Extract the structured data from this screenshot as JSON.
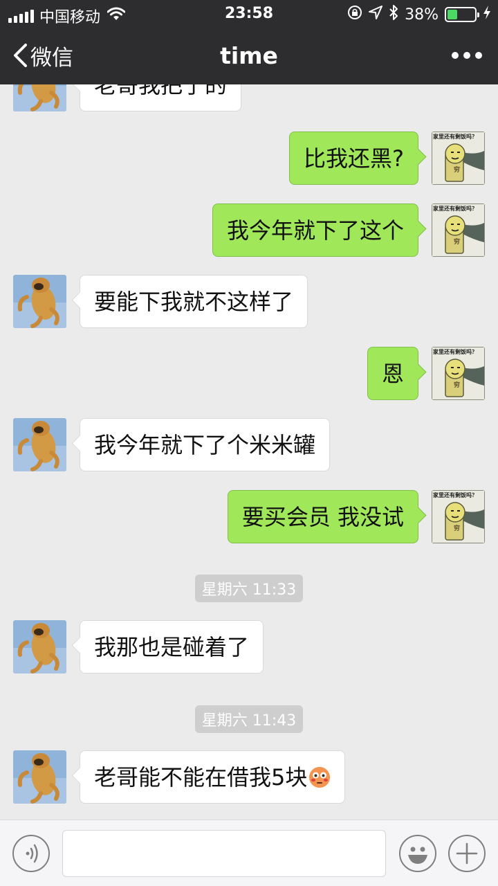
{
  "status_bar": {
    "carrier": "中国移动",
    "time": "23:58",
    "battery_percent": "38%",
    "battery_level": 0.38,
    "icons": [
      "signal-icon",
      "wifi-icon",
      "lock-rotation-icon",
      "location-icon",
      "bluetooth-icon",
      "battery-icon",
      "charging-icon"
    ]
  },
  "nav": {
    "back_label": "微信",
    "title": "time",
    "more_icon": "more-icon"
  },
  "colors": {
    "nav_bg": "#2d2d2f",
    "chat_bg": "#ebebeb",
    "outgoing_bubble": "#a0e75a",
    "incoming_bubble": "#ffffff",
    "battery_fill": "#4cd964"
  },
  "messages": [
    {
      "direction": "in",
      "text": "老哥我把了的"
    },
    {
      "direction": "out",
      "text": "比我还黑?"
    },
    {
      "direction": "out",
      "text": "我今年就下了这个"
    },
    {
      "direction": "in",
      "text": "要能下我就不这样了"
    },
    {
      "direction": "out",
      "text": "恩"
    },
    {
      "direction": "in",
      "text": "我今年就下了个米米罐"
    },
    {
      "direction": "out",
      "text": "要买会员 我没试"
    },
    {
      "direction": "in",
      "text": "我那也是碰着了"
    },
    {
      "direction": "in",
      "text": "老哥能不能在借我5块",
      "emoji": "flushed-face-icon"
    }
  ],
  "timestamps": [
    "星期六 11:33",
    "星期六 11:43"
  ],
  "my_avatar_caption": "家里还有剩饭吗？",
  "my_avatar_label": "穷",
  "input_bar": {
    "value": "",
    "left_icon": "voice-icon",
    "emoji_icon": "emoji-icon",
    "plus_icon": "plus-icon"
  }
}
